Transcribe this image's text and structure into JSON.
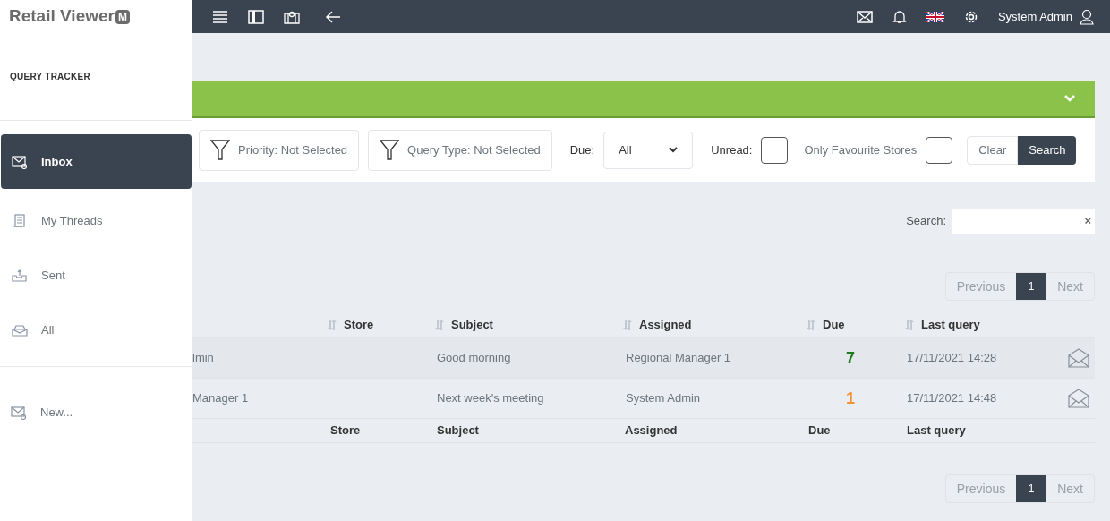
{
  "logo": {
    "text": "Retail Viewer",
    "badge": "M"
  },
  "topbar": {
    "user": "System Admin"
  },
  "sidebar": {
    "title": "QUERY TRACKER",
    "items": [
      {
        "label": "Inbox",
        "kind": "inbox",
        "selected": true
      },
      {
        "label": "My Threads",
        "kind": "threads",
        "selected": false
      },
      {
        "label": "Sent",
        "kind": "sent",
        "selected": false
      },
      {
        "label": "All",
        "kind": "all",
        "selected": false
      }
    ],
    "new_item": {
      "label": "New...",
      "kind": "new"
    }
  },
  "filters": {
    "priority": "Priority: Not Selected",
    "query_type": "Query Type: Not Selected",
    "due_label": "Due:",
    "due_value": "All",
    "unread_label": "Unread:",
    "unread_checked": false,
    "favourite_label": "Only Favourite Stores",
    "favourite_checked": false,
    "clear": "Clear",
    "search": "Search"
  },
  "search": {
    "label": "Search:",
    "clear": "×"
  },
  "pagination_top": {
    "previous": "Previous",
    "pages": [
      {
        "label": "1",
        "selected": true
      }
    ],
    "next": "Next"
  },
  "table": {
    "columns": [
      "Store",
      "Subject",
      "Assigned",
      "Due",
      "Last query"
    ],
    "rows": [
      {
        "column_1": "lmin",
        "subject": "Good morning",
        "assigned": "Regional Manager 1",
        "due": "7",
        "color": "#1e7b1e",
        "last_query": "17/11/2021 14:28"
      },
      {
        "column_1": "Manager 1",
        "subject": "Next week's meeting",
        "assigned": "System Admin",
        "due": "1",
        "color": "#f39233",
        "last_query": "17/11/2021 14:48"
      }
    ],
    "footer": [
      "Store",
      "Subject",
      "Assigned",
      "Due",
      "Last query"
    ]
  },
  "pagination_bottom": {
    "previous": "Previous",
    "pages": [
      {
        "label": "1",
        "selected": true
      }
    ],
    "next": "Next"
  }
}
